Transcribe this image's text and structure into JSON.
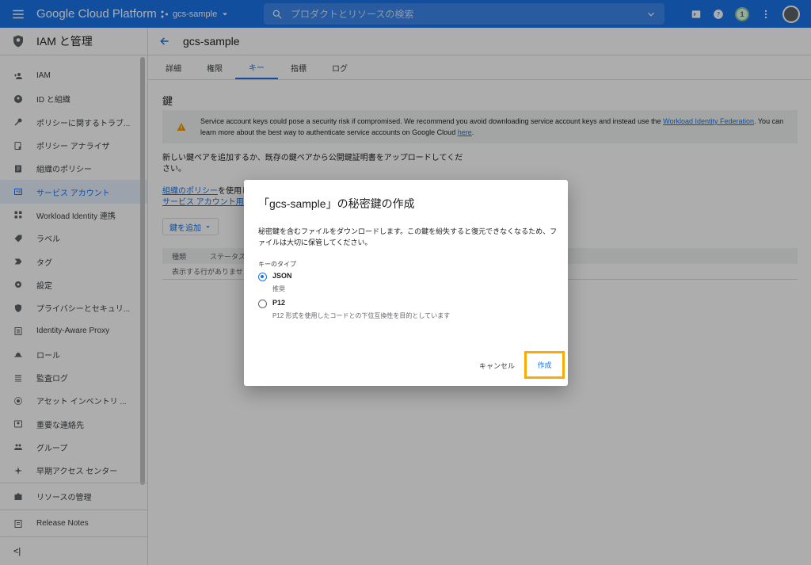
{
  "topbar": {
    "brand": "Google Cloud Platform",
    "project": "gcs-sample",
    "search_placeholder": "プロダクトとリソースの検索",
    "notification_count": "1"
  },
  "sidebar": {
    "title": "IAM と管理",
    "items": [
      {
        "label": "IAM",
        "icon": "person-add-icon"
      },
      {
        "label": "ID と組織",
        "icon": "account-circle-icon"
      },
      {
        "label": "ポリシーに関するトラブ...",
        "icon": "wrench-icon"
      },
      {
        "label": "ポリシー アナライザ",
        "icon": "analyzer-icon"
      },
      {
        "label": "組織のポリシー",
        "icon": "policy-doc-icon"
      },
      {
        "label": "サービス アカウント",
        "icon": "service-account-icon",
        "active": true
      },
      {
        "label": "Workload Identity 連携",
        "icon": "workload-identity-icon"
      },
      {
        "label": "ラベル",
        "icon": "label-icon"
      },
      {
        "label": "タグ",
        "icon": "tag-icon"
      },
      {
        "label": "設定",
        "icon": "gear-icon"
      },
      {
        "label": "プライバシーとセキュリ...",
        "icon": "shield-icon"
      },
      {
        "label": "Identity-Aware Proxy",
        "icon": "proxy-icon"
      },
      {
        "label": "ロール",
        "icon": "role-icon"
      },
      {
        "label": "監査ログ",
        "icon": "list-icon"
      },
      {
        "label": "アセット インベントリ ...",
        "icon": "asset-icon"
      },
      {
        "label": "重要な連絡先",
        "icon": "contact-icon"
      },
      {
        "label": "グループ",
        "icon": "group-icon"
      },
      {
        "label": "早期アクセス センター",
        "icon": "early-access-icon"
      }
    ],
    "bottom": [
      {
        "label": "リソースの管理",
        "icon": "resource-icon"
      },
      {
        "label": "Release Notes",
        "icon": "notes-icon"
      }
    ],
    "collapse": "<|"
  },
  "main": {
    "title": "gcs-sample",
    "tabs": [
      "詳細",
      "権限",
      "キー",
      "指標",
      "ログ"
    ],
    "active_tab": 2,
    "section_title": "鍵",
    "warning": {
      "text1": "Service account keys could pose a security risk if compromised. We recommend you avoid downloading service account keys and instead use the ",
      "link1": "Workload Identity Federation",
      "text2": ". You can learn more about the best way to authenticate service accounts on Google Cloud ",
      "link2": "here",
      "text3": "."
    },
    "description": "新しい鍵ペアを追加するか、既存の鍵ペアから公開鍵証明書をアップロードしてください。",
    "policy_link": "組織のポリシー",
    "policy_text": "を使用し",
    "service_account_link": "サービス アカウント用の",
    "add_key_label": "鍵を追加",
    "table_headers": [
      "種類",
      "ステータス"
    ],
    "table_empty": "表示する行がありませ"
  },
  "dialog": {
    "title": "「gcs-sample」の秘密鍵の作成",
    "description": "秘密鍵を含むファイルをダウンロードします。この鍵を紛失すると復元できなくなるため、ファイルは大切に保管してください。",
    "key_type_label": "キーのタイプ",
    "options": [
      {
        "label": "JSON",
        "sub": "推奨",
        "checked": true
      },
      {
        "label": "P12",
        "sub": "P12 形式を使用したコードとの下位互換性を目的としています",
        "checked": false
      }
    ],
    "cancel_label": "キャンセル",
    "create_label": "作成"
  },
  "colors": {
    "accent": "#1a73e8",
    "highlight": "#f9ab00",
    "warning": "#f29900"
  }
}
